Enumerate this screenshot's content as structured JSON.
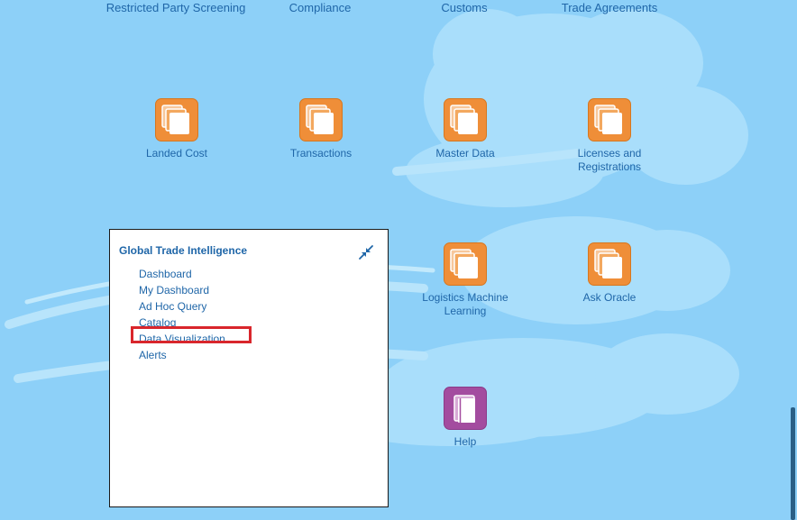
{
  "top_links": [
    "Restricted Party Screening",
    "Compliance",
    "Customs",
    "Trade Agreements"
  ],
  "tiles": {
    "landed_cost": "Landed Cost",
    "transactions": "Transactions",
    "master_data": "Master Data",
    "licenses": [
      "Licenses and",
      "Registrations"
    ],
    "logistics_ml": [
      "Logistics Machine",
      "Learning"
    ],
    "ask_oracle": "Ask Oracle",
    "help": "Help"
  },
  "panel": {
    "title": "Global Trade Intelligence",
    "items": [
      "Dashboard",
      "My Dashboard",
      "Ad Hoc Query",
      "Catalog",
      "Data Visualization",
      "Alerts"
    ],
    "highlighted_item": "Data Visualization"
  },
  "icons": {
    "tile_icon": "stacked-pages-icon",
    "help_icon": "book-icon",
    "collapse_icon": "collapse-arrows-icon"
  },
  "colors": {
    "sky": "#8dd0f8",
    "link": "#1f66a8",
    "tile_orange": "#ef8e38",
    "tile_purple": "#a34c9f",
    "highlight": "#d9262c"
  }
}
